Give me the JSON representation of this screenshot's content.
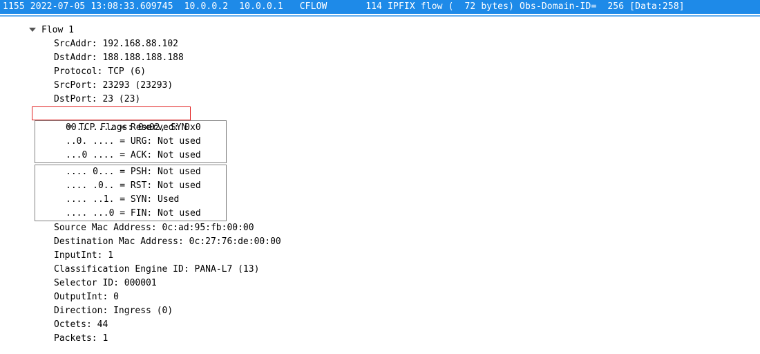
{
  "topbar": {
    "packet_no": "1155",
    "timestamp": "2022-07-05 13:08:33.609745",
    "src_ip": "10.0.0.2",
    "dst_ip": "10.0.0.1",
    "protocol": "CFLOW",
    "length": "114",
    "info_prefix": "IPFIX flow (",
    "info_bytes": "  72 bytes)",
    "obs_domain_label": " Obs-Domain-ID=",
    "obs_domain_val": "  256",
    "data_suffix": " [Data:258]"
  },
  "flow_header": "Flow 1",
  "fields": {
    "src_addr": "SrcAddr: 192.168.88.102",
    "dst_addr": "DstAddr: 188.188.188.188",
    "protocol": "Protocol: TCP (6)",
    "src_port": "SrcPort: 23293 (23293)",
    "dst_port": "DstPort: 23 (23)"
  },
  "tcp_flags_header": "TCP Flags: 0x02, SYN",
  "flag_box1": {
    "l1": "00.. .... = Reserved: 0x0",
    "l2": "..0. .... = URG: Not used",
    "l3": "...0 .... = ACK: Not used"
  },
  "flag_box2": {
    "l1": ".... 0... = PSH: Not used",
    "l2": ".... .0.. = RST: Not used",
    "l3": ".... ..1. = SYN: Used",
    "l4": ".... ...0 = FIN: Not used"
  },
  "tail": {
    "src_mac": "Source Mac Address: 0c:ad:95:fb:00:00",
    "dst_mac": "Destination Mac Address: 0c:27:76:de:00:00",
    "input_int": "InputInt: 1",
    "ce_id": "Classification Engine ID: PANA-L7 (13)",
    "selector_id": "Selector ID: 000001",
    "output_int": "OutputInt: 0",
    "direction": "Direction: Ingress (0)",
    "octets": "Octets: 44",
    "packets": "Packets: 1"
  }
}
